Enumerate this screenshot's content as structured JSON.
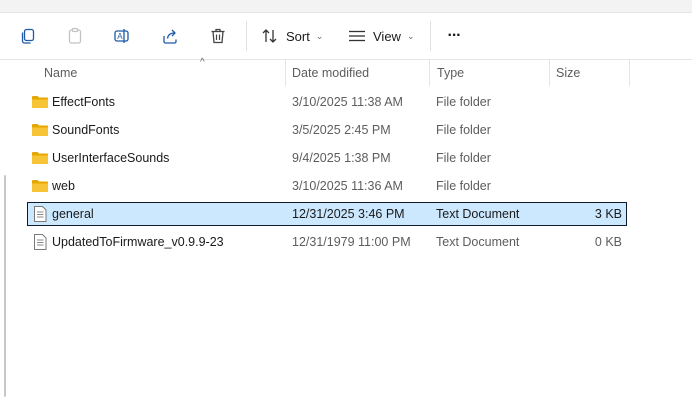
{
  "toolbar": {
    "sort_label": "Sort",
    "view_label": "View",
    "more_label": "···"
  },
  "columns": {
    "name": "Name",
    "date": "Date modified",
    "type": "Type",
    "size": "Size"
  },
  "files": [
    {
      "name": "EffectFonts",
      "date": "3/10/2025 11:38 AM",
      "type": "File folder",
      "size": "",
      "kind": "folder"
    },
    {
      "name": "SoundFonts",
      "date": "3/5/2025 2:45 PM",
      "type": "File folder",
      "size": "",
      "kind": "folder"
    },
    {
      "name": "UserInterfaceSounds",
      "date": "9/4/2025 1:38 PM",
      "type": "File folder",
      "size": "",
      "kind": "folder"
    },
    {
      "name": "web",
      "date": "3/10/2025 11:36 AM",
      "type": "File folder",
      "size": "",
      "kind": "folder"
    },
    {
      "name": "general",
      "date": "12/31/2025 3:46 PM",
      "type": "Text Document",
      "size": "3 KB",
      "kind": "text",
      "selected": true
    },
    {
      "name": "UpdatedToFirmware_v0.9.9-23",
      "date": "12/31/1979 11:00 PM",
      "type": "Text Document",
      "size": "0 KB",
      "kind": "text"
    }
  ],
  "colors": {
    "selection": "#cce8ff",
    "folder": "#f4b400",
    "accent": "#1e5aa8"
  }
}
